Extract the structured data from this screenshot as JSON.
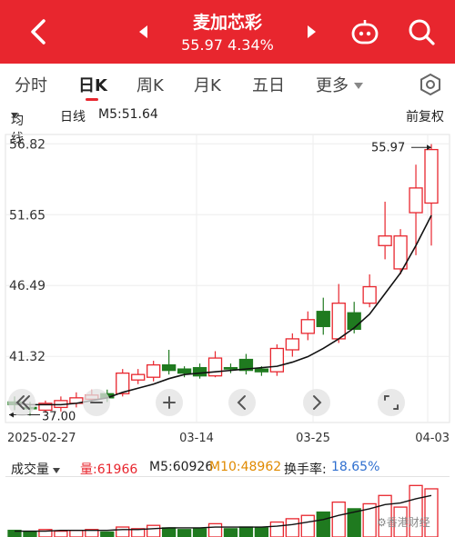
{
  "header": {
    "stock_name": "麦加芯彩",
    "price": "55.97",
    "change_pct": "4.34%",
    "bg_color": "#e8262e"
  },
  "tabs": [
    {
      "label": "分时"
    },
    {
      "label": "日K",
      "active": true
    },
    {
      "label": "周K"
    },
    {
      "label": "月K"
    },
    {
      "label": "五日"
    },
    {
      "label": "更多"
    }
  ],
  "info": {
    "ma_type": "均线",
    "period": "日线",
    "ma5": "M5:51.64",
    "adjust": "前复权"
  },
  "chart_data": {
    "type": "candlestick",
    "y_ticks": [
      "56.82",
      "51.65",
      "46.49",
      "41.32"
    ],
    "x_ticks": [
      "2025-02-27",
      "03-14",
      "03-25",
      "04-03"
    ],
    "price_max_label": "55.97",
    "price_min_label": "37.00",
    "candles": [
      {
        "o": 38.0,
        "c": 37.8,
        "h": 38.4,
        "l": 37.4
      },
      {
        "o": 37.6,
        "c": 37.5,
        "h": 38.0,
        "l": 37.0
      },
      {
        "o": 37.4,
        "c": 37.9,
        "h": 38.1,
        "l": 37.2
      },
      {
        "o": 37.6,
        "c": 38.1,
        "h": 38.4,
        "l": 37.3
      },
      {
        "o": 37.9,
        "c": 38.3,
        "h": 38.7,
        "l": 37.6
      },
      {
        "o": 38.2,
        "c": 38.5,
        "h": 38.9,
        "l": 37.9
      },
      {
        "o": 38.6,
        "c": 38.3,
        "h": 38.9,
        "l": 38.0
      },
      {
        "o": 38.6,
        "c": 40.1,
        "h": 40.4,
        "l": 38.4
      },
      {
        "o": 39.6,
        "c": 40.0,
        "h": 40.4,
        "l": 39.3
      },
      {
        "o": 39.8,
        "c": 40.7,
        "h": 41.0,
        "l": 39.5
      },
      {
        "o": 40.7,
        "c": 40.3,
        "h": 41.8,
        "l": 40.0
      },
      {
        "o": 40.4,
        "c": 40.1,
        "h": 40.6,
        "l": 39.8
      },
      {
        "o": 40.5,
        "c": 39.9,
        "h": 40.8,
        "l": 39.7
      },
      {
        "o": 39.9,
        "c": 41.2,
        "h": 41.7,
        "l": 39.8
      },
      {
        "o": 40.5,
        "c": 40.4,
        "h": 40.8,
        "l": 40.1
      },
      {
        "o": 41.1,
        "c": 40.3,
        "h": 41.5,
        "l": 40.0
      },
      {
        "o": 40.4,
        "c": 40.2,
        "h": 40.6,
        "l": 39.9
      },
      {
        "o": 40.2,
        "c": 41.9,
        "h": 42.2,
        "l": 39.9
      },
      {
        "o": 41.8,
        "c": 42.6,
        "h": 43.0,
        "l": 41.3
      },
      {
        "o": 43.0,
        "c": 44.0,
        "h": 44.6,
        "l": 42.5
      },
      {
        "o": 44.6,
        "c": 43.5,
        "h": 45.6,
        "l": 42.9
      },
      {
        "o": 42.6,
        "c": 45.2,
        "h": 46.6,
        "l": 42.3
      },
      {
        "o": 44.5,
        "c": 43.3,
        "h": 45.3,
        "l": 43.0
      },
      {
        "o": 45.2,
        "c": 46.4,
        "h": 47.3,
        "l": 44.9
      },
      {
        "o": 49.4,
        "c": 50.1,
        "h": 52.6,
        "l": 48.4
      },
      {
        "o": 47.7,
        "c": 50.1,
        "h": 50.6,
        "l": 47.3
      },
      {
        "o": 51.8,
        "c": 53.6,
        "h": 55.3,
        "l": 48.7
      },
      {
        "o": 52.5,
        "c": 56.4,
        "h": 56.8,
        "l": 49.4
      }
    ],
    "ma5": [
      37.9,
      37.8,
      37.8,
      37.8,
      37.9,
      38.1,
      38.3,
      38.7,
      39.0,
      39.3,
      39.7,
      40.0,
      40.1,
      40.2,
      40.3,
      40.4,
      40.5,
      40.6,
      40.9,
      41.3,
      41.9,
      42.6,
      43.4,
      44.4,
      45.9,
      47.4,
      49.4,
      51.6
    ],
    "ylim": [
      36.5,
      57.5
    ]
  },
  "nav_buttons": [
    "back-double",
    "zoom-out",
    "zoom-in",
    "prev",
    "next",
    "fullscreen"
  ],
  "volume": {
    "label": "成交量",
    "vol": "量:61966",
    "m5": "M5:60926",
    "m10": "M10:48962",
    "turnover_label": "换手率:",
    "turnover": "18.65%",
    "watermark": "⚙香港财经"
  },
  "volume_data": {
    "values": [
      8,
      6,
      9,
      7,
      8,
      9,
      6,
      12,
      10,
      14,
      11,
      9,
      10,
      16,
      10,
      12,
      11,
      18,
      22,
      26,
      30,
      42,
      34,
      40,
      50,
      36,
      62,
      58
    ],
    "ma": [
      7,
      7,
      7,
      8,
      8,
      8,
      8,
      9,
      9,
      10,
      11,
      11,
      11,
      12,
      12,
      12,
      12,
      13,
      15,
      18,
      21,
      26,
      30,
      34,
      39,
      41,
      46,
      50
    ],
    "vmax": 70
  }
}
